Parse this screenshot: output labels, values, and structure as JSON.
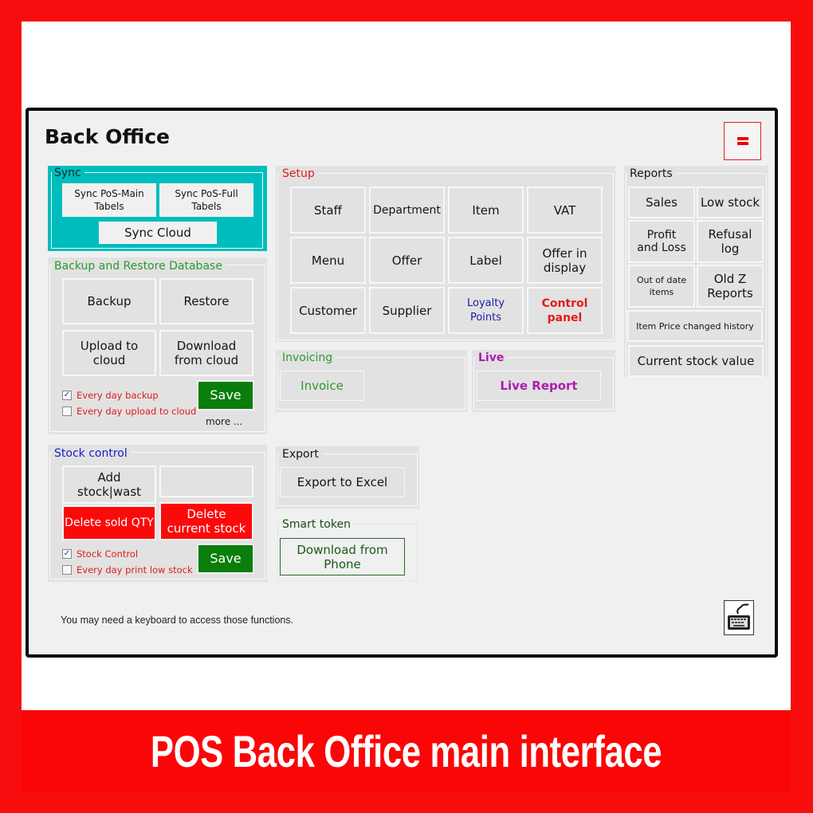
{
  "window": {
    "title": "Back Office",
    "menu_button": "hamburger-menu",
    "hint": "You may need a keyboard to access those functions.",
    "keyboard_button": "keyboard-icon"
  },
  "sync": {
    "legend": "Sync",
    "buttons": [
      "Sync PoS-Main Tabels",
      "Sync PoS-Full Tabels",
      "Sync Cloud"
    ]
  },
  "backup": {
    "legend": "Backup and Restore Database",
    "buttons": [
      "Backup",
      "Restore",
      "Upload to cloud",
      "Download from cloud"
    ],
    "checkboxes": [
      {
        "label": "Every day backup",
        "checked": true
      },
      {
        "label": "Every day upload to cloud",
        "checked": false
      }
    ],
    "save": "Save",
    "more": "more ..."
  },
  "stock": {
    "legend": "Stock control",
    "buttons": [
      "Add stock|wast",
      "",
      "Delete sold QTY",
      "Delete current stock"
    ],
    "checkboxes": [
      {
        "label": "Stock Control",
        "checked": true
      },
      {
        "label": "Every day print low stock",
        "checked": false
      }
    ],
    "save": "Save"
  },
  "setup": {
    "legend": "Setup",
    "buttons": [
      "Staff",
      "Department",
      "Item",
      "VAT",
      "Menu",
      "Offer",
      "Label",
      "Offer in display",
      "Customer",
      "Supplier",
      "Loyalty Points",
      "Control panel"
    ]
  },
  "invoicing": {
    "legend": "Invoicing",
    "button": "Invoice"
  },
  "live": {
    "legend": "Live",
    "button": "Live Report"
  },
  "export": {
    "legend": "Export",
    "button": "Export to Excel"
  },
  "smart_token": {
    "legend": "Smart token",
    "button": "Download from Phone"
  },
  "reports": {
    "legend": "Reports",
    "buttons": [
      "Sales",
      "Low stock",
      "Profit and Loss",
      "Refusal log",
      "Out of date items",
      "Old Z Reports",
      "Item Price changed history",
      "Current stock value"
    ]
  },
  "caption": "POS Back Office main interface",
  "colors": {
    "frame": "#f70d0d",
    "sync_bg": "#00bfbf",
    "save": "#0a7d0a",
    "danger": "#fb0a0a",
    "setup_legend": "#e31b1b",
    "backup_legend": "#2a9a2a",
    "stock_legend": "#1a1ad0",
    "live": "#b01ab0"
  }
}
